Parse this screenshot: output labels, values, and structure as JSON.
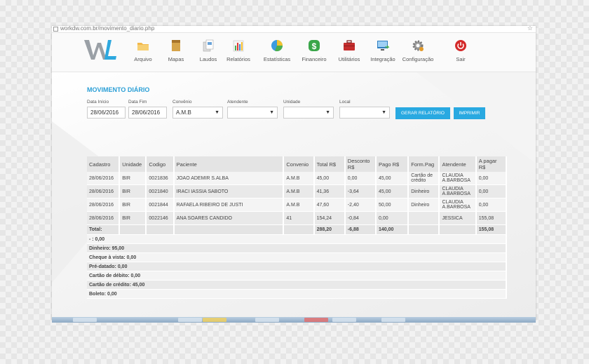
{
  "browser": {
    "url": "workdw.com.br/movimento_diario.php"
  },
  "nav": [
    {
      "label": "Arquivo",
      "icon": "folder-icon",
      "color": "#f2b84b"
    },
    {
      "label": "Mapas",
      "icon": "map-icon",
      "color": "#d6a44a"
    },
    {
      "label": "Laudos",
      "icon": "documents-icon",
      "color": "#6aa3d8"
    },
    {
      "label": "Relatórios",
      "icon": "bar-chart-icon",
      "color": "#4a89c9"
    },
    {
      "label": "Estatísticas",
      "icon": "pie-chart-icon",
      "color": "#3b9be0"
    },
    {
      "label": "Financeiro",
      "icon": "dollar-icon",
      "color": "#3aa64a"
    },
    {
      "label": "Utilitários",
      "icon": "toolbox-icon",
      "color": "#c62d2d"
    },
    {
      "label": "Integração",
      "icon": "monitor-icon",
      "color": "#2f7fc1"
    },
    {
      "label": "Configuração",
      "icon": "gear-icon",
      "color": "#e29a2a"
    },
    {
      "label": "Sair",
      "icon": "power-icon",
      "color": "#d42a2a"
    }
  ],
  "page": {
    "title": "MOVIMENTO DIÁRIO"
  },
  "filters": {
    "data_inicio": {
      "label": "Data Início",
      "value": "28/06/2016"
    },
    "data_fim": {
      "label": "Data Fim",
      "value": "28/06/2016"
    },
    "convenio": {
      "label": "Convênio",
      "value": "A.M.B"
    },
    "atendente": {
      "label": "Atendente",
      "value": ""
    },
    "unidade": {
      "label": "Unidade",
      "value": ""
    },
    "local": {
      "label": "Local",
      "value": ""
    }
  },
  "buttons": {
    "gerar": "GERAR RELATÓRIO",
    "imprimir": "IMPRIMIR"
  },
  "table": {
    "headers": [
      "Cadastro",
      "Unidade",
      "Codigo",
      "Paciente",
      "Convenio",
      "Total R$",
      "Desconto R$",
      "Pago R$",
      "Form.Pag",
      "Atendente",
      "A pagar R$"
    ],
    "rows": [
      [
        "28/06/2016",
        "BIR",
        "0021836",
        "JOAO ADEMIR S.ALBA",
        "A.M.B",
        "45,00",
        "0,00",
        "45,00",
        "Cartão de crédito",
        "CLAUDIA A.BARBOSA",
        "0,00"
      ],
      [
        "28/06/2016",
        "BIR",
        "0021840",
        "IRACI IASSIA SABOTO",
        "A.M.B",
        "41,36",
        "-3,64",
        "45,00",
        "Dinheiro",
        "CLAUDIA A.BARBOSA",
        "0,00"
      ],
      [
        "28/06/2016",
        "BIR",
        "0021844",
        "RAFAELA RIBEIRO DE JUSTI",
        "A.M.B",
        "47,60",
        "-2,40",
        "50,00",
        "Dinheiro",
        "CLAUDIA A.BARBOSA",
        "0,00"
      ],
      [
        "28/06/2016",
        "BIR",
        "0022146",
        "ANA SOARES CANDIDO",
        "41",
        "154,24",
        "-0,84",
        "0,00",
        "",
        "JESSICA",
        "155,08"
      ]
    ],
    "total": {
      "label": "Total:",
      "total": "288,20",
      "desconto": "-6,88",
      "pago": "140,00",
      "a_pagar": "155,08"
    },
    "summary": [
      "- : 0,00",
      "Dinheiro: 95,00",
      "Cheque à vista: 0,00",
      "Pré-datado: 0,00",
      "Cartão de débito: 0,00",
      "Cartão de crédito: 45,00",
      "Boleto: 0,00"
    ]
  },
  "colors": {
    "accent": "#2b9fd6",
    "button": "#29a9e1"
  }
}
